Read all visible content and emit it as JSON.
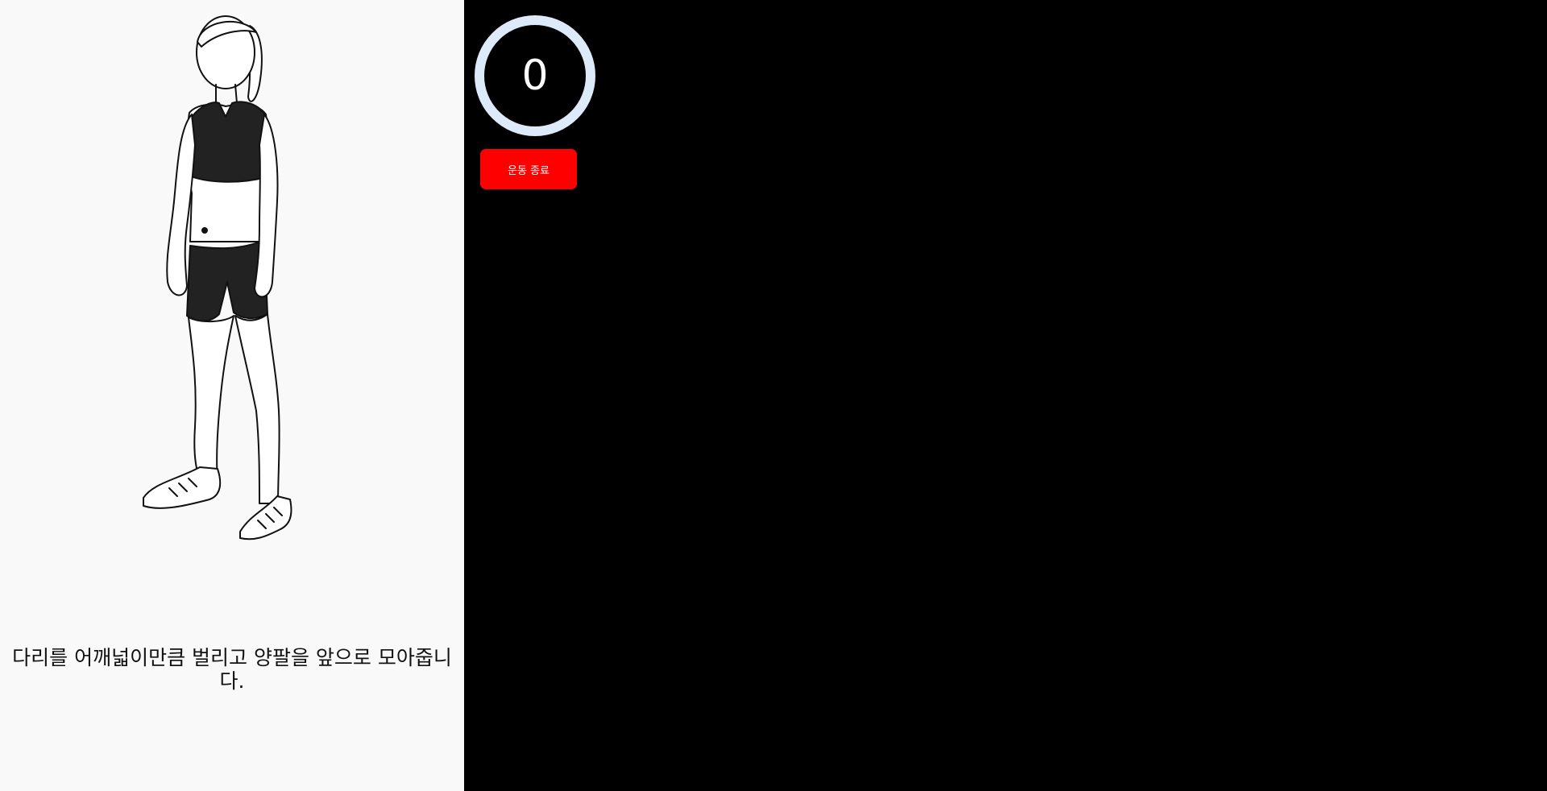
{
  "exercise": {
    "instruction": "다리를 어깨넓이만큼 벌리고 양팔을 앞으로 모아줍니다.",
    "illustration_icon": "standing-woman-illustration"
  },
  "counter": {
    "value": "0",
    "ring_color": "#dceaf9"
  },
  "controls": {
    "end_label": "운동 종료",
    "end_color": "#ff0000"
  },
  "colors": {
    "left_background": "#f9f9f9",
    "right_background": "#000000"
  }
}
